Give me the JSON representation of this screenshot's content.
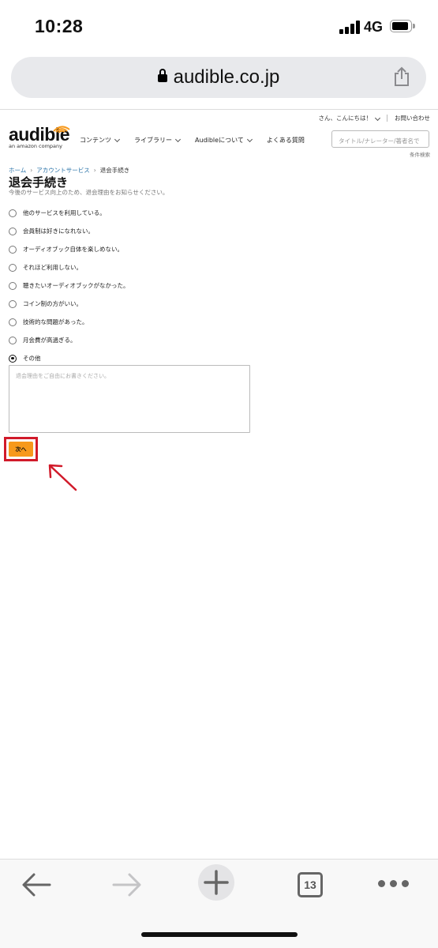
{
  "status_bar": {
    "time": "10:28",
    "network": "4G"
  },
  "browser": {
    "url": "audible.co.jp"
  },
  "header": {
    "greeting": "さん、こんにちは！",
    "contact": "お問い合わせ",
    "logo_word": "audible",
    "logo_sub": "an amazon company",
    "nav": [
      "コンテンツ",
      "ライブラリー",
      "Audibleについて",
      "よくある質問"
    ],
    "search_placeholder": "タイトル/ナレーター/著者名で",
    "advanced_search": "条件検索"
  },
  "breadcrumb": {
    "home": "ホーム",
    "account": "アカウントサービス",
    "current": "退会手続き"
  },
  "page": {
    "title": "退会手続き",
    "subtitle": "今後のサービス向上のため、退会理由をお知らせください。"
  },
  "options": [
    {
      "label": "他のサービスを利用している。",
      "checked": false
    },
    {
      "label": "会員制は好きになれない。",
      "checked": false
    },
    {
      "label": "オーディオブック自体を楽しめない。",
      "checked": false
    },
    {
      "label": "それほど利用しない。",
      "checked": false
    },
    {
      "label": "聴きたいオーディオブックがなかった。",
      "checked": false
    },
    {
      "label": "コイン制の方がいい。",
      "checked": false
    },
    {
      "label": "技術的な問題があった。",
      "checked": false
    },
    {
      "label": "月会費が高過ぎる。",
      "checked": false
    },
    {
      "label": "その他",
      "checked": true
    }
  ],
  "reason_placeholder": "退会理由をご自由にお書きください。",
  "next_button": "次へ",
  "colors": {
    "accent": "#f7991c",
    "highlight": "#d11a2a",
    "link": "#2a73a8"
  },
  "toolbar": {
    "tab_count": "13"
  }
}
